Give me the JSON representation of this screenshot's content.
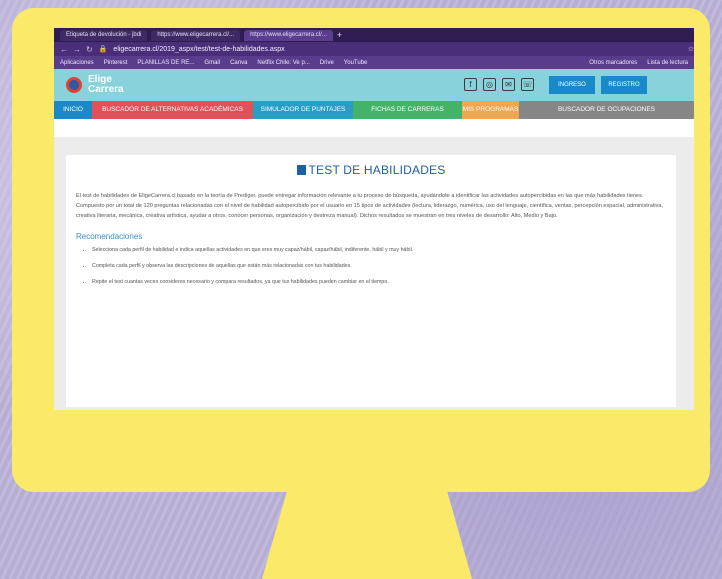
{
  "browser": {
    "tabs": [
      "Etiqueta de devolución - jbdi",
      "https://www.eligecarrera.cl/...",
      "https://www.eligecarrera.cl/..."
    ],
    "url": "eligecarrera.cl/2019_aspx/test/test-de-habilidades.aspx",
    "bookmarks": [
      "Aplicaciones",
      "Pinterest",
      "PLANILLAS DE RE...",
      "Gmail",
      "Canva",
      "Netflix Chile: Ve p...",
      "Drive",
      "YouTube"
    ],
    "bookmarks_right": [
      "Otros marcadores",
      "Lista de lectura"
    ]
  },
  "site": {
    "logo_line1": "Elige",
    "logo_line2": "Carrera",
    "login": "INGRESO",
    "register": "REGISTRO"
  },
  "menu": [
    "INICIO",
    "BUSCADOR DE ALTERNATIVAS ACADÉMICAS",
    "SIMULADOR DE PUNTAJES",
    "FICHAS DE CARRERAS",
    "MIS PROGRAMAS",
    "BUSCADOR DE OCUPACIONES"
  ],
  "page": {
    "title": "TEST DE HABILIDADES",
    "intro": "El test de habilidades de EligeCarrera.cl basado en la teoría de Prediger, puede entregar información relevante a tu proceso de búsqueda, ayudándote a identificar las actividades autopercibidas en las que más habilidades tienes. Compuesto por un total de 120 preguntas relacionadas con el nivel de habilidad autopercibido por el usuario en 15 tipos de actividades (lectura, liderazgo, numérica, uso del lenguaje, científica, ventas, percepción espacial, administrativa, creativa literaria, mecánica, creativa artística, ayudar a otros, conocer personas, organización y destreza manual). Dichos resultados se muestran en tres niveles de desarrollo: Alto, Medio y Bajo.",
    "recs_title": "Recomendaciones",
    "recs": [
      "Selecciona cada perfil de habilidad e indica aquellas actividades en que eres muy capaz/hábil, capaz/hábil, indiferente, hábil y muy hábil.",
      "Completa cada perfil y observa las descripciones de aquellas que están más relacionadas con tus habilidades.",
      "Repite el test cuantas veces consideres necesario y compara resultados, ya que tus habilidades pueden cambiar en el tiempo."
    ]
  },
  "colors": {
    "frame": "#fbe96a",
    "header": "#88d2dc",
    "accent": "#1f5fa5"
  }
}
